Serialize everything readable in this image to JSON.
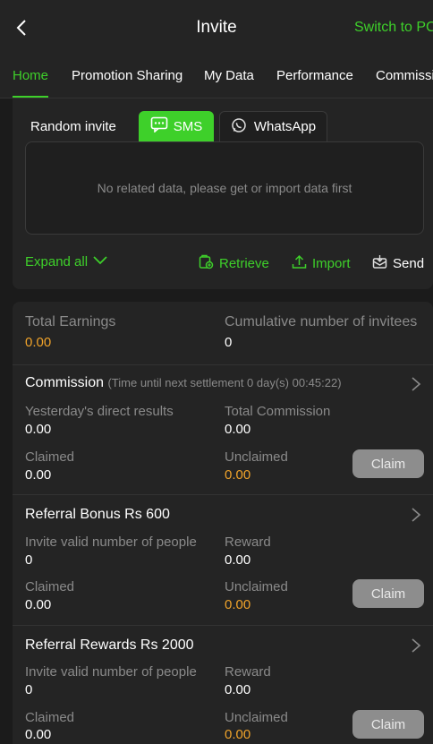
{
  "header": {
    "title": "Invite",
    "switch_label": "Switch to PC"
  },
  "tabs": [
    "Home",
    "Promotion Sharing",
    "My Data",
    "Performance",
    "Commission"
  ],
  "invite": {
    "random_label": "Random invite",
    "sms_label": "SMS",
    "whatsapp_label": "WhatsApp",
    "empty_text": "No related data, please get or import data first",
    "expand_label": "Expand all",
    "retrieve_label": "Retrieve",
    "import_label": "Import",
    "send_label": "Send"
  },
  "summary": {
    "total_earnings_label": "Total Earnings",
    "total_earnings_value": "0.00",
    "invitees_label": "Cumulative number of invitees",
    "invitees_value": "0"
  },
  "commission": {
    "title": "Commission",
    "subtitle": "(Time until next settlement  0 day(s) 00:45:22)",
    "yesterday_label": "Yesterday's direct results",
    "yesterday_value": "0.00",
    "total_label": "Total Commission",
    "total_value": "0.00",
    "claimed_label": "Claimed",
    "claimed_value": "0.00",
    "unclaimed_label": "Unclaimed",
    "unclaimed_value": "0.00",
    "claim_label": "Claim"
  },
  "referral_bonus": {
    "title": "Referral Bonus Rs 600",
    "invite_label": "Invite valid number of people",
    "invite_value": "0",
    "reward_label": "Reward",
    "reward_value": "0.00",
    "claimed_label": "Claimed",
    "claimed_value": "0.00",
    "unclaimed_label": "Unclaimed",
    "unclaimed_value": "0.00",
    "claim_label": "Claim"
  },
  "referral_rewards": {
    "title": "Referral Rewards Rs 2000",
    "invite_label": "Invite valid number of people",
    "invite_value": "0",
    "reward_label": "Reward",
    "reward_value": "0.00",
    "claimed_label": "Claimed",
    "claimed_value": "0.00",
    "unclaimed_label": "Unclaimed",
    "unclaimed_value": "0.00",
    "claim_label": "Claim"
  },
  "colors": {
    "accent": "#3ed02a",
    "orange": "#f0a32a",
    "background": "#1b1b1b",
    "card": "#242424"
  }
}
